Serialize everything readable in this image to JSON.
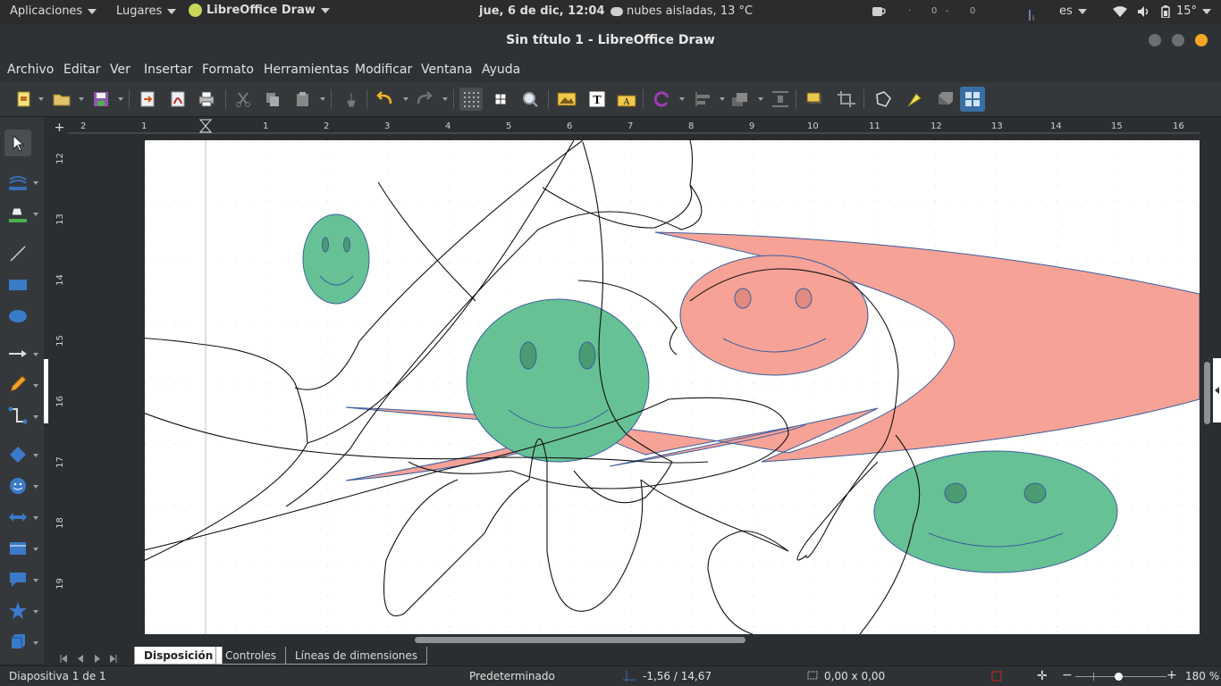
{
  "topbar": {
    "applications": "Aplicaciones",
    "places": "Lugares",
    "app_name": "LibreOffice Draw",
    "datetime": "jue,  6 de dic, 12:04",
    "weather": "nubes aisladas, 13 °C",
    "net_down": "0",
    "net_up": "0",
    "language": "es",
    "brightness": "15°"
  },
  "window": {
    "title": "Sin título 1 - LibreOffice Draw"
  },
  "menu": [
    "Archivo",
    "Editar",
    "Ver",
    "Insertar",
    "Formato",
    "Herramientas",
    "Modificar",
    "Ventana",
    "Ayuda"
  ],
  "rulers": {
    "h_ticks": [
      "2",
      "1",
      "1",
      "2",
      "3",
      "4",
      "5",
      "6",
      "7",
      "8",
      "9",
      "10",
      "11",
      "12",
      "13",
      "14",
      "15",
      "16"
    ],
    "v_ticks": [
      "12",
      "13",
      "14",
      "15",
      "16",
      "17",
      "18",
      "19"
    ]
  },
  "tabs": [
    "Disposición",
    "Controles",
    "Líneas de dimensiones"
  ],
  "status": {
    "slide": "Diapositiva 1 de 1",
    "layout": "Predeterminado",
    "position": "-1,56 / 14,67",
    "size": "0,00 x 0,00",
    "zoom": "180 %"
  },
  "colors": {
    "green_smiley": "#66c194",
    "salmon_shape": "#f6a296",
    "outline": "#3a5f9e",
    "accent_yellow": "#f5a623"
  }
}
